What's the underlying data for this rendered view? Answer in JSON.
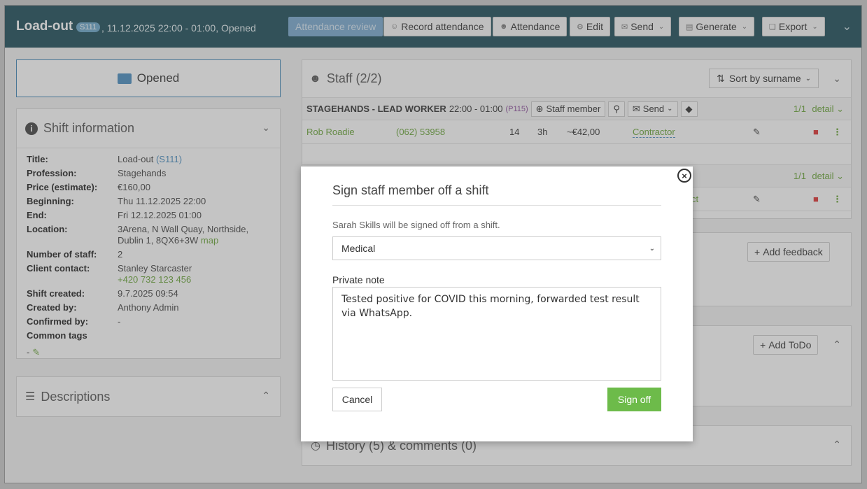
{
  "header": {
    "title": "Load-out",
    "code": "S111",
    "subtitle": ", 11.12.2025 22:00 - 01:00, Opened",
    "buttons": {
      "attendance_review": "Attendance review",
      "record_attendance": "Record attendance",
      "attendance": "Attendance",
      "edit": "Edit",
      "send": "Send",
      "generate": "Generate",
      "export": "Export"
    }
  },
  "status_button": "Opened",
  "shift_info": {
    "heading": "Shift information",
    "rows": [
      {
        "k": "Title:",
        "v": "Load-out",
        "extra": "(S111)"
      },
      {
        "k": "Profession:",
        "v": "Stagehands"
      },
      {
        "k": "Price (estimate):",
        "v": "€160,00"
      },
      {
        "k": "Beginning:",
        "v": "Thu 11.12.2025 22:00"
      },
      {
        "k": "End:",
        "v": "Fri 12.12.2025 01:00"
      },
      {
        "k": "Location:",
        "v": "3Arena, N Wall Quay, Northside, Dublin 1, 8QX6+3W",
        "extra": "map"
      },
      {
        "k": "Number of staff:",
        "v": "2"
      },
      {
        "k": "Client contact:",
        "v": "Stanley Starcaster",
        "extra": "+420 732 123 456"
      },
      {
        "k": "Shift created:",
        "v": "9.7.2025 09:54"
      },
      {
        "k": "Created by:",
        "v": "Anthony Admin"
      },
      {
        "k": "Confirmed by:",
        "v": "-"
      },
      {
        "k": "Common tags",
        "v": ""
      }
    ],
    "tags_value": "-"
  },
  "descriptions": {
    "heading": "Descriptions"
  },
  "staff": {
    "heading": "Staff (2/2)",
    "sort_label": "Sort by surname",
    "group": {
      "name": "STAGEHANDS - LEAD WORKER",
      "time": "22:00 - 01:00",
      "code": "(P115)",
      "staff_member_btn": "Staff member",
      "send_btn": "Send",
      "count": "1/1",
      "detail": "detail"
    },
    "row": {
      "name": "Rob Roadie",
      "phone": "(062) 53958",
      "num": "14",
      "hours": "3h",
      "price": "~€42,00",
      "type": "Contractor"
    },
    "group2": {
      "count": "1/1",
      "detail": "detail",
      "type_partial": "ct"
    }
  },
  "feedback": {
    "add_label": "Add feedback"
  },
  "todo": {
    "add_label": "Add ToDo"
  },
  "history": {
    "heading": "History (5) & comments (0)"
  },
  "modal": {
    "title": "Sign staff member off a shift",
    "description": "Sarah Skills will be signed off from a shift.",
    "reason_selected": "Medical",
    "note_label": "Private note",
    "note_value": "Tested positive for COVID this morning, forwarded test result via WhatsApp.",
    "cancel": "Cancel",
    "submit": "Sign off"
  }
}
